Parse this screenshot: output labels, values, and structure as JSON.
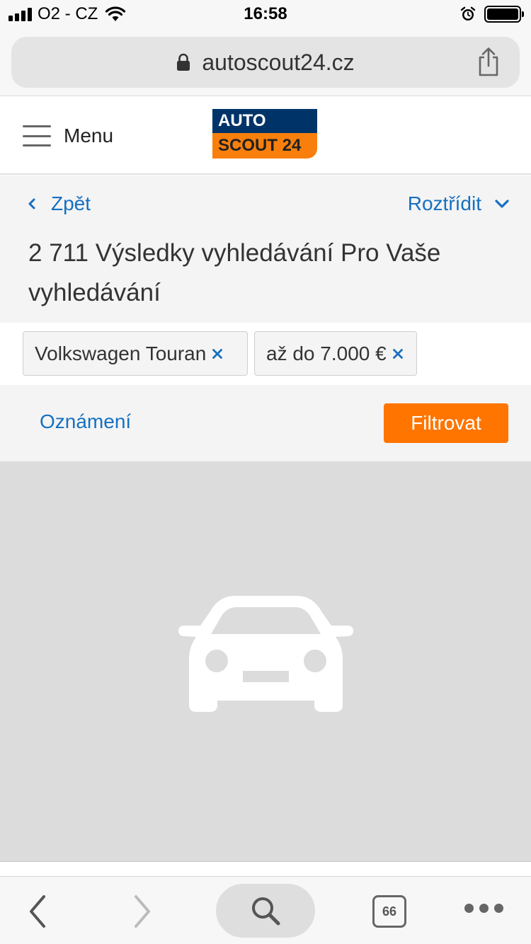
{
  "status_bar": {
    "carrier": "O2 - CZ",
    "time": "16:58",
    "icons": [
      "signal-icon",
      "wifi-icon",
      "alarm-icon",
      "battery-icon"
    ]
  },
  "browser": {
    "url": "autoscout24.cz",
    "icons": [
      "lock-icon",
      "share-icon"
    ],
    "tab_count": "66"
  },
  "header": {
    "menu_label": "Menu",
    "logo_top": "AUTO",
    "logo_bottom": "SCOUT 24"
  },
  "results": {
    "back_label": "Zpět",
    "sort_label": "Roztřídit",
    "title": "2 711 Výsledky vyhledávání Pro Vaše vyhledávání"
  },
  "filters": {
    "chips": [
      "Volkswagen Touran",
      "až do 7.000 €"
    ]
  },
  "actions": {
    "notice_label": "Oznámení",
    "filter_label": "Filtrovat"
  },
  "colors": {
    "accent_blue": "#1670c1",
    "accent_orange": "#ff7500",
    "logo_navy": "#003468",
    "logo_orange": "#f97f0c"
  }
}
